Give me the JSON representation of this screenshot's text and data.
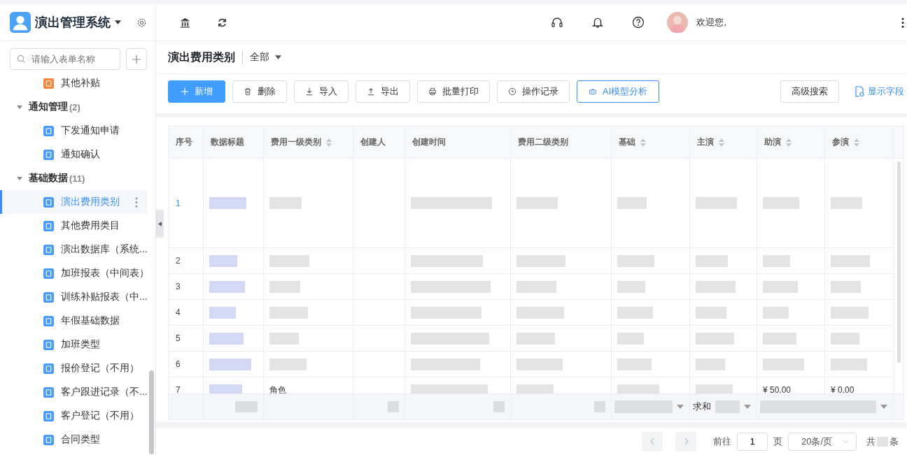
{
  "sidebar": {
    "app_title": "演出管理系统",
    "search": {
      "placeholder": "请输入表单名称"
    },
    "items": [
      {
        "kind": "form",
        "label": "其他补贴",
        "color": "#f5843c",
        "selected": false
      },
      {
        "kind": "group",
        "label": "通知管理",
        "count": "(2)",
        "expanded": true,
        "children": [
          {
            "kind": "form",
            "label": "下发通知申请",
            "color": "#4a9cf8",
            "selected": false
          },
          {
            "kind": "form",
            "label": "通知确认",
            "color": "#4a9cf8",
            "selected": false
          }
        ]
      },
      {
        "kind": "group",
        "label": "基础数据",
        "count": "(11)",
        "expanded": true,
        "children": [
          {
            "kind": "form",
            "label": "演出费用类别",
            "color": "#4a9cf8",
            "selected": true
          },
          {
            "kind": "form",
            "label": "其他费用类目",
            "color": "#4a9cf8",
            "selected": false
          },
          {
            "kind": "form",
            "label": "演出数据库（系统...",
            "color": "#4a9cf8",
            "selected": false
          },
          {
            "kind": "form",
            "label": "加班报表（中间表）",
            "color": "#4a9cf8",
            "selected": false
          },
          {
            "kind": "form",
            "label": "训练补贴报表（中...",
            "color": "#4a9cf8",
            "selected": false
          },
          {
            "kind": "form",
            "label": "年假基础数据",
            "color": "#4a9cf8",
            "selected": false
          },
          {
            "kind": "form",
            "label": "加班类型",
            "color": "#4a9cf8",
            "selected": false
          },
          {
            "kind": "form",
            "label": "报价登记（不用）",
            "color": "#4a9cf8",
            "selected": false
          },
          {
            "kind": "form",
            "label": "客户跟进记录（不...",
            "color": "#4a9cf8",
            "selected": false
          },
          {
            "kind": "form",
            "label": "客户登记（不用）",
            "color": "#4a9cf8",
            "selected": false
          },
          {
            "kind": "form",
            "label": "合同类型",
            "color": "#4a9cf8",
            "selected": false
          }
        ]
      }
    ]
  },
  "header": {
    "greeting": "欢迎您,"
  },
  "page": {
    "title": "演出费用类别",
    "filter": "全部"
  },
  "toolbar": {
    "buttons": [
      {
        "kind": "primary",
        "label": "新增"
      },
      {
        "kind": "default",
        "label": "删除"
      },
      {
        "kind": "default",
        "label": "导入"
      },
      {
        "kind": "default",
        "label": "导出"
      },
      {
        "kind": "default",
        "label": "批量打印"
      },
      {
        "kind": "default",
        "label": "操作记录"
      },
      {
        "kind": "accent",
        "label": "AI模型分析"
      }
    ],
    "right": [
      {
        "kind": "default",
        "label": "高级搜索"
      },
      {
        "kind": "link",
        "label": "显示字段"
      }
    ]
  },
  "table": {
    "columns": [
      {
        "label": "序号",
        "sortable": false
      },
      {
        "label": "数据标题",
        "sortable": false
      },
      {
        "label": "费用一级类别",
        "sortable": true
      },
      {
        "label": "创建人",
        "sortable": false
      },
      {
        "label": "创建时间",
        "sortable": false
      },
      {
        "label": "费用二级类别",
        "sortable": false
      },
      {
        "label": "基础",
        "sortable": true
      },
      {
        "label": "主演",
        "sortable": true
      },
      {
        "label": "助演",
        "sortable": true
      },
      {
        "label": "参演",
        "sortable": true
      }
    ],
    "rows": [
      {
        "hovered": true,
        "tall": true,
        "cells": [
          {
            "kind": "index",
            "text": "1"
          },
          {
            "kind": "redacted"
          },
          {
            "kind": "redacted"
          },
          {
            "kind": "empty"
          },
          {
            "kind": "redacted"
          },
          {
            "kind": "redacted"
          },
          {
            "kind": "redacted"
          },
          {
            "kind": "redacted"
          },
          {
            "kind": "redacted"
          },
          {
            "kind": "redacted"
          }
        ]
      },
      {
        "hovered": false,
        "tall": false,
        "cells": [
          {
            "kind": "index",
            "text": "2"
          },
          {
            "kind": "redacted"
          },
          {
            "kind": "redacted"
          },
          {
            "kind": "empty"
          },
          {
            "kind": "redacted"
          },
          {
            "kind": "redacted"
          },
          {
            "kind": "redacted"
          },
          {
            "kind": "redacted"
          },
          {
            "kind": "redacted"
          },
          {
            "kind": "redacted"
          }
        ]
      },
      {
        "hovered": false,
        "tall": false,
        "cells": [
          {
            "kind": "index",
            "text": "3"
          },
          {
            "kind": "redacted"
          },
          {
            "kind": "redacted"
          },
          {
            "kind": "empty"
          },
          {
            "kind": "redacted"
          },
          {
            "kind": "redacted"
          },
          {
            "kind": "redacted"
          },
          {
            "kind": "redacted"
          },
          {
            "kind": "redacted"
          },
          {
            "kind": "redacted"
          }
        ]
      },
      {
        "hovered": false,
        "tall": false,
        "cells": [
          {
            "kind": "index",
            "text": "4"
          },
          {
            "kind": "redacted"
          },
          {
            "kind": "redacted"
          },
          {
            "kind": "empty"
          },
          {
            "kind": "redacted"
          },
          {
            "kind": "redacted"
          },
          {
            "kind": "redacted"
          },
          {
            "kind": "redacted"
          },
          {
            "kind": "redacted"
          },
          {
            "kind": "redacted"
          }
        ]
      },
      {
        "hovered": false,
        "tall": false,
        "cells": [
          {
            "kind": "index",
            "text": "5"
          },
          {
            "kind": "redacted"
          },
          {
            "kind": "redacted"
          },
          {
            "kind": "empty"
          },
          {
            "kind": "redacted"
          },
          {
            "kind": "redacted"
          },
          {
            "kind": "redacted"
          },
          {
            "kind": "redacted"
          },
          {
            "kind": "redacted"
          },
          {
            "kind": "redacted"
          }
        ]
      },
      {
        "hovered": false,
        "tall": false,
        "cells": [
          {
            "kind": "index",
            "text": "6"
          },
          {
            "kind": "redacted"
          },
          {
            "kind": "redacted"
          },
          {
            "kind": "empty"
          },
          {
            "kind": "redacted"
          },
          {
            "kind": "redacted"
          },
          {
            "kind": "redacted"
          },
          {
            "kind": "redacted"
          },
          {
            "kind": "redacted"
          },
          {
            "kind": "redacted"
          }
        ]
      },
      {
        "hovered": false,
        "tall": false,
        "cells": [
          {
            "kind": "index",
            "text": "7"
          },
          {
            "kind": "redacted"
          },
          {
            "kind": "text",
            "text": "角色"
          },
          {
            "kind": "empty"
          },
          {
            "kind": "redacted"
          },
          {
            "kind": "redacted"
          },
          {
            "kind": "redacted"
          },
          {
            "kind": "redacted"
          },
          {
            "kind": "text",
            "text": "¥ 50.00"
          },
          {
            "kind": "text",
            "text": "¥ 0.00"
          }
        ]
      }
    ],
    "footer": [
      {
        "kind": "empty"
      },
      {
        "kind": "redacted"
      },
      {
        "kind": "empty"
      },
      {
        "kind": "redacted"
      },
      {
        "kind": "redacted"
      },
      {
        "kind": "redacted"
      },
      {
        "kind": "select"
      },
      {
        "kind": "select",
        "text": "求和"
      },
      {
        "kind": "select",
        "span": true
      }
    ]
  },
  "pagination": {
    "goto": "前往",
    "page": "1",
    "unit": "页",
    "page_size": "20条/页",
    "total_prefix": "共",
    "total_suffix": "条"
  }
}
